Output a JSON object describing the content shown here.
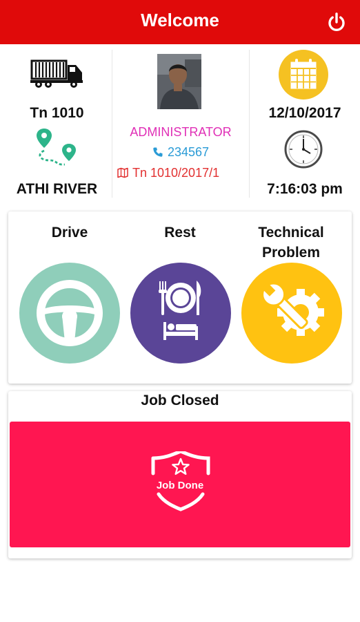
{
  "header": {
    "title": "Welcome",
    "power_icon": "power-icon"
  },
  "vehicle": {
    "icon": "truck-icon",
    "number": "Tn 1010",
    "route_icon": "route-icon",
    "location": "ATHI RIVER"
  },
  "driver": {
    "role": "ADMINISTRATOR",
    "phone": "234567",
    "trip": "Tn 1010/2017/1"
  },
  "datetime": {
    "calendar_icon": "calendar-icon",
    "date": "12/10/2017",
    "clock_icon": "clock-icon",
    "time": "7:16:03 pm"
  },
  "activities": [
    {
      "label": "Drive",
      "icon": "steering-wheel-icon",
      "color": "#8fceba"
    },
    {
      "label": "Rest",
      "icon": "meal-bed-icon",
      "color": "#5a4597"
    },
    {
      "label": "Technical Problem",
      "icon": "wrench-gear-icon",
      "color": "#ffc211"
    }
  ],
  "job": {
    "title": "Job Closed",
    "button_label": "Job Done",
    "icon": "shield-star-icon",
    "color": "#ff1651"
  },
  "colors": {
    "header": "#e00a0a",
    "role": "#e02fb6",
    "phone": "#2a9bd6",
    "trip": "#e23030",
    "route_icon": "#2db48a",
    "calendar": "#f5c122"
  }
}
